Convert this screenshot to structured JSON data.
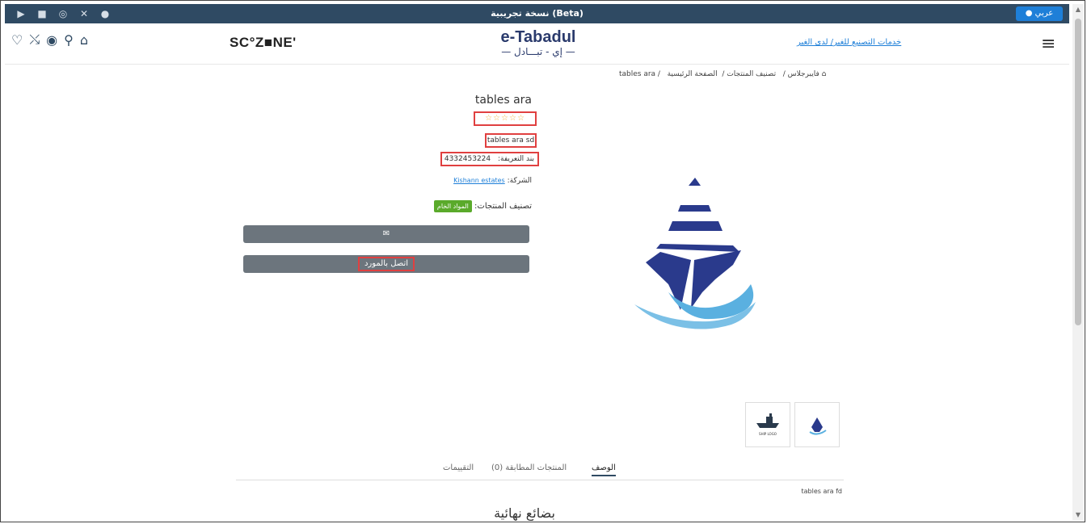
{
  "topbar": {
    "beta_label": "نسخة تجريبية (Beta)",
    "lang_label": "عربي",
    "social_icons": [
      "youtube-icon",
      "linkedin-icon",
      "instagram-icon",
      "x-icon",
      "facebook-icon"
    ]
  },
  "header": {
    "scozone": "SC°Z■NE'",
    "logo_line1": "e-Tabadul",
    "logo_line2": "— إي - تبـــادل —",
    "services_link": "خدمات التصنيع للغير/ لدى الغير"
  },
  "breadcrumb": {
    "home": "الصفحة الرئيسية",
    "cat": "تصنيف المنتجات /",
    "sub": "فايبرجلاس /",
    "current": "tables ara /"
  },
  "product": {
    "title": "tables ara",
    "stars": "☆☆☆☆☆",
    "subtitle": "tables ara sd",
    "sku_label": "بند التعريفة:",
    "sku_value": "4332453224",
    "company_label": "الشركة:",
    "company_value": "Kishann estates",
    "category_label": "تصنيف المنتجات:",
    "category_value": "المواد الخام",
    "contact_label": "اتصل بالمورد"
  },
  "tabs": {
    "description": "الوصف",
    "matching": "المنتجات المطابقة (0)",
    "reviews": "التقييمات"
  },
  "description_text": "tables ara fd",
  "section_title": "بضائع نهائية",
  "thumbs": {
    "ship_logo_text": "SHIP LOGO"
  },
  "colors": {
    "topbar": "#2f4a63",
    "lang_button": "#1e7fd8",
    "category_tag": "#5aaa2b",
    "highlight_box": "#e04040",
    "ship_navy": "#2a3a8c",
    "wave_blue": "#5ab0e0"
  }
}
